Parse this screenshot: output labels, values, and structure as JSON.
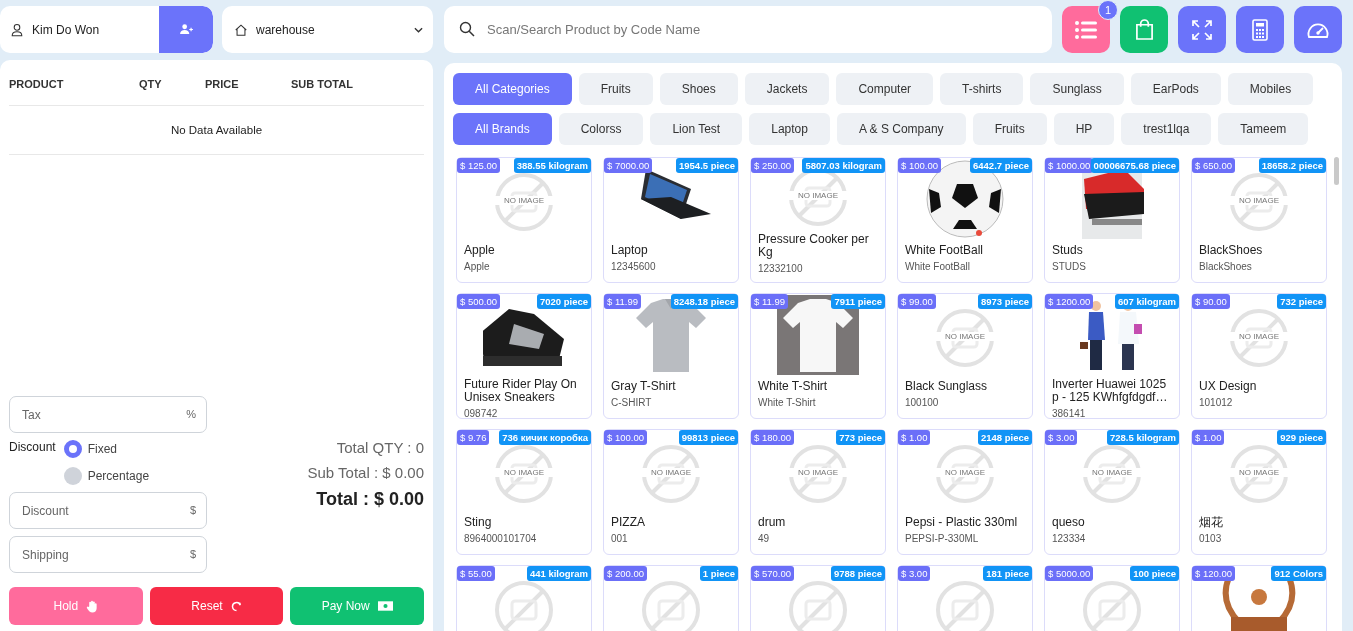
{
  "customer": {
    "name": "Kim Do Won"
  },
  "warehouse": {
    "value": "warehouse"
  },
  "cart": {
    "columns": [
      "PRODUCT",
      "QTY",
      "PRICE",
      "SUB TOTAL"
    ],
    "empty_text": "No Data Available"
  },
  "tax": {
    "placeholder": "Tax",
    "unit": "%"
  },
  "discount_type": {
    "label": "Discount",
    "options": [
      {
        "label": "Fixed",
        "selected": true
      },
      {
        "label": "Percentage",
        "selected": false
      }
    ]
  },
  "discount": {
    "placeholder": "Discount",
    "unit": "$"
  },
  "shipping": {
    "placeholder": "Shipping",
    "unit": "$"
  },
  "totals": {
    "qty": "Total QTY : 0",
    "sub_total": "Sub Total : $ 0.00",
    "total": "Total : $ 0.00"
  },
  "actions": [
    {
      "kind": "hold",
      "label": "Hold"
    },
    {
      "kind": "reset",
      "label": "Reset"
    },
    {
      "kind": "pay",
      "label": "Pay Now"
    }
  ],
  "search": {
    "placeholder": "Scan/Search Product by Code Name"
  },
  "toolbar": [
    {
      "kind": "list",
      "badge": "1"
    },
    {
      "kind": "bag"
    },
    {
      "kind": "expand"
    },
    {
      "kind": "calculator"
    },
    {
      "kind": "gauge"
    }
  ],
  "categories": [
    {
      "label": "All Categories",
      "selected": true
    },
    {
      "label": "Fruits",
      "selected": false
    },
    {
      "label": "Shoes",
      "selected": false
    },
    {
      "label": "Jackets",
      "selected": false
    },
    {
      "label": "Computer",
      "selected": false
    },
    {
      "label": "T-shirts",
      "selected": false
    },
    {
      "label": "Sunglass",
      "selected": false
    },
    {
      "label": "EarPods",
      "selected": false
    },
    {
      "label": "Mobiles",
      "selected": false
    }
  ],
  "brands": [
    {
      "label": "All Brands",
      "selected": true
    },
    {
      "label": "Colorss",
      "selected": false
    },
    {
      "label": "Lion Test",
      "selected": false
    },
    {
      "label": "Laptop",
      "selected": false
    },
    {
      "label": "A & S Company",
      "selected": false
    },
    {
      "label": "Fruits",
      "selected": false
    },
    {
      "label": "HP",
      "selected": false
    },
    {
      "label": "trest1lqa",
      "selected": false
    },
    {
      "label": "Tameem",
      "selected": false
    }
  ],
  "products": [
    {
      "price": "$ 125.00",
      "stock": "388.55 kilogram",
      "kind": "no_image",
      "image_text": "NO IMAGE",
      "name": "Apple",
      "code": "Apple"
    },
    {
      "price": "$ 7000.00",
      "stock": "1954.5 piece",
      "kind": "picture",
      "name": "Laptop",
      "code": "12345600"
    },
    {
      "price": "$ 250.00",
      "stock": "5807.03 kilogram",
      "kind": "no_image",
      "image_text": "NO IMAGE",
      "name": "Pressure Cooker per Kg",
      "code": "12332100"
    },
    {
      "price": "$ 100.00",
      "stock": "6442.7 piece",
      "kind": "picture",
      "name": "White FootBall",
      "code": "White FootBall"
    },
    {
      "price": "$ 1000.00",
      "stock": "00006675.68 piece",
      "kind": "picture",
      "name": "Studs",
      "code": "STUDS"
    },
    {
      "price": "$ 650.00",
      "stock": "18658.2 piece",
      "kind": "no_image",
      "image_text": "NO IMAGE",
      "name": "BlackShoes",
      "code": "BlackShoes"
    },
    {
      "price": "$ 500.00",
      "stock": "7020 piece",
      "kind": "picture",
      "name": "Future Rider Play On Unisex Sneakers",
      "code": "098742"
    },
    {
      "price": "$ 11.99",
      "stock": "8248.18 piece",
      "kind": "picture",
      "name": "Gray T-Shirt",
      "code": "C-SHIRT"
    },
    {
      "price": "$ 11.99",
      "stock": "7911 piece",
      "kind": "picture",
      "name": "White T-Shirt",
      "code": "White T-Shirt"
    },
    {
      "price": "$ 99.00",
      "stock": "8973 piece",
      "kind": "no_image",
      "image_text": "NO IMAGE",
      "name": "Black Sunglass",
      "code": "100100"
    },
    {
      "price": "$ 1200.00",
      "stock": "607 kilogram",
      "kind": "picture",
      "name": "Inverter Huawei 1025 p - 125 KWhfgfdgdf…",
      "code": "386141"
    },
    {
      "price": "$ 90.00",
      "stock": "732 piece",
      "kind": "no_image",
      "image_text": "NO IMAGE",
      "name": "UX Design",
      "code": "101012"
    },
    {
      "price": "$ 9.76",
      "stock": "736 кичик коробка",
      "kind": "no_image",
      "image_text": "NO IMAGE",
      "name": "Sting",
      "code": "8964000101704"
    },
    {
      "price": "$ 100.00",
      "stock": "99813 piece",
      "kind": "no_image",
      "image_text": "NO IMAGE",
      "name": "PIZZA",
      "code": "001"
    },
    {
      "price": "$ 180.00",
      "stock": "773 piece",
      "kind": "no_image",
      "image_text": "NO IMAGE",
      "name": "drum",
      "code": "49"
    },
    {
      "price": "$ 1.00",
      "stock": "2148 piece",
      "kind": "no_image",
      "image_text": "NO IMAGE",
      "name": "Pepsi - Plastic 330ml",
      "code": "PEPSI-P-330ML"
    },
    {
      "price": "$ 3.00",
      "stock": "728.5 kilogram",
      "kind": "no_image",
      "image_text": "NO IMAGE",
      "name": "queso",
      "code": "123334"
    },
    {
      "price": "$ 1.00",
      "stock": "929 piece",
      "kind": "no_image",
      "image_text": "NO IMAGE",
      "name": "烟花",
      "code": "0103"
    },
    {
      "price": "$ 55.00",
      "stock": "441 kilogram",
      "kind": "no_image"
    },
    {
      "price": "$ 200.00",
      "stock": "1 piece",
      "kind": "no_image"
    },
    {
      "price": "$ 570.00",
      "stock": "9788 piece",
      "kind": "no_image"
    },
    {
      "price": "$ 3.00",
      "stock": "181 piece",
      "kind": "no_image"
    },
    {
      "price": "$ 5000.00",
      "stock": "100 piece",
      "kind": "no_image"
    },
    {
      "price": "$ 120.00",
      "stock": "912 Colors",
      "kind": "picture"
    }
  ]
}
